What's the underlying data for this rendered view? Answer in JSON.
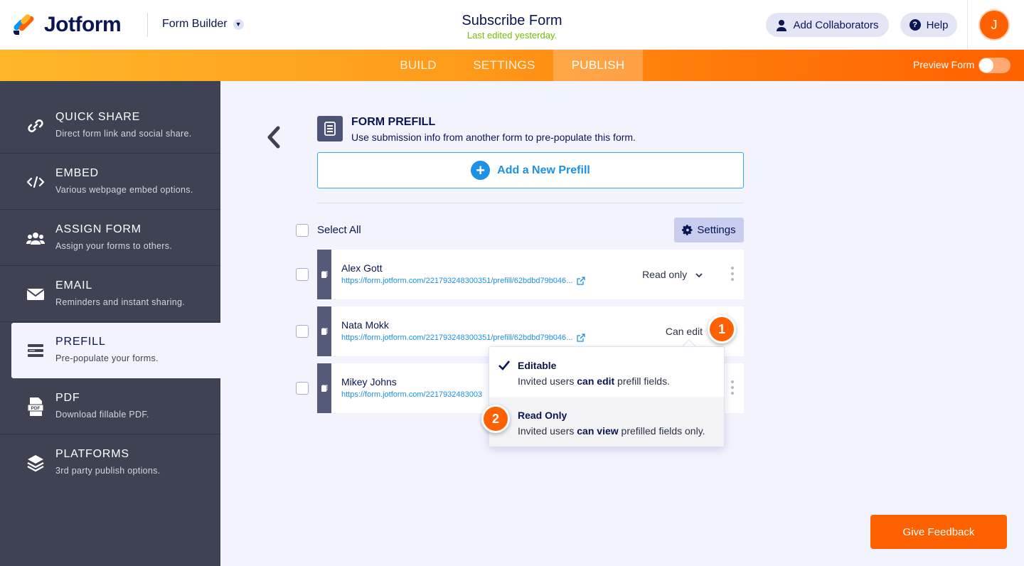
{
  "header": {
    "brand": "Jotform",
    "builder_label": "Form Builder",
    "form_title": "Subscribe Form",
    "last_edited": "Last edited yesterday.",
    "add_collaborators": "Add Collaborators",
    "help": "Help",
    "avatar_initial": "J",
    "brand_color": "#ff6100"
  },
  "nav": {
    "tabs": [
      {
        "label": "BUILD"
      },
      {
        "label": "SETTINGS"
      },
      {
        "label": "PUBLISH",
        "active": true
      }
    ],
    "preview_form": "Preview Form"
  },
  "sidebar": {
    "items": [
      {
        "label": "QUICK SHARE",
        "desc": "Direct form link and social share.",
        "icon": "link-icon"
      },
      {
        "label": "EMBED",
        "desc": "Various webpage embed options.",
        "icon": "code-icon"
      },
      {
        "label": "ASSIGN FORM",
        "desc": "Assign your forms to others.",
        "icon": "users-icon"
      },
      {
        "label": "EMAIL",
        "desc": "Reminders and instant sharing.",
        "icon": "envelope-icon"
      },
      {
        "label": "PREFILL",
        "desc": "Pre-populate your forms.",
        "icon": "prefill-icon",
        "active": true
      },
      {
        "label": "PDF",
        "desc": "Download fillable PDF.",
        "icon": "pdf-icon"
      },
      {
        "label": "PLATFORMS",
        "desc": "3rd party publish options.",
        "icon": "layers-icon"
      }
    ]
  },
  "prefill": {
    "title": "FORM PREFILL",
    "subtitle": "Use submission info from another form to pre-populate this form.",
    "add_button": "Add a New Prefill",
    "select_all": "Select All",
    "settings_button": "Settings",
    "rows": [
      {
        "name": "Alex Gott",
        "url": "https://form.jotform.com/221793248300351/prefill/62bdbd79b046...",
        "permission": "Read only"
      },
      {
        "name": "Nata Mokk",
        "url": "https://form.jotform.com/221793248300351/prefill/62bdbd79b046...",
        "permission": "Can edit"
      },
      {
        "name": "Mikey Johns",
        "url": "https://form.jotform.com/2217932483003",
        "permission": ""
      }
    ]
  },
  "dropdown": {
    "options": [
      {
        "title": "Editable",
        "desc_prefix": "Invited users ",
        "desc_bold": "can edit",
        "desc_suffix": " prefill fields.",
        "selected": true
      },
      {
        "title": "Read Only",
        "desc_prefix": "Invited users ",
        "desc_bold": "can view",
        "desc_suffix": " prefilled fields only.",
        "selected": false
      }
    ]
  },
  "callouts": [
    "1",
    "2"
  ],
  "feedback_button": "Give Feedback"
}
